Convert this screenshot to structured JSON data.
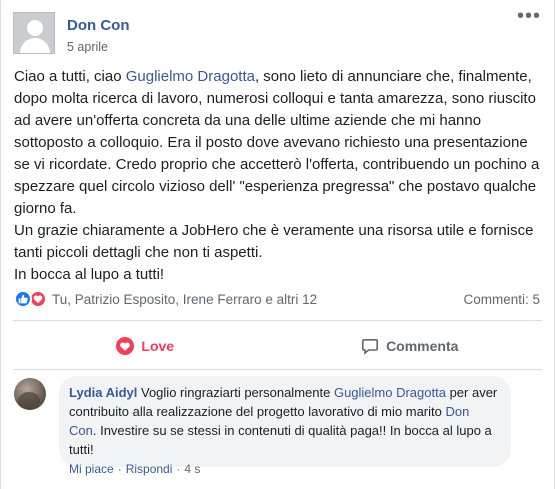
{
  "post": {
    "author": "Don Con",
    "date": "5 aprile",
    "more_glyph": "•••",
    "paragraphs": [
      {
        "t1": "Ciao a tutti, ciao ",
        "mention": "Guglielmo Dragotta",
        "t2": ", sono lieto di annunciare che, finalmente, dopo molta ricerca di lavoro, numerosi colloqui e tanta amarezza, sono riuscito ad avere un'offerta concreta da una delle ultime aziende che mi hanno sottoposto a colloquio. Era il posto dove avevano richiesto una presentazione se vi ricordate. Credo proprio che accetterò l'offerta, contribuendo un pochino a spezzare quel circolo vizioso dell' \"esperienza pregressa\" che postavo qualche giorno fa."
      },
      {
        "text": "Un grazie chiaramente a JobHero che è veramente una risorsa utile e fornisce tanti piccoli dettagli che non ti aspetti."
      },
      {
        "text": "In bocca al lupo a tutti!"
      }
    ]
  },
  "reactions": {
    "names": "Tu, Patrizio Esposito, Irene Ferraro e altri 12",
    "comments_count": "Commenti: 5",
    "colors": {
      "like": "#1877f2",
      "love": "#f33e58"
    }
  },
  "actions": {
    "love_label": "Love",
    "comment_label": "Commenta"
  },
  "comment": {
    "author": "Lydia Aidyl",
    "t1": " Voglio ringraziarti personalmente ",
    "mention1": "Guglielmo Dragotta",
    "t2": " per aver contribuito alla realizzazione del progetto lavorativo di mio marito ",
    "mention2": "Don Con",
    "t3": ". Investire su se stessi in contenuti di qualità paga!! In bocca al lupo a tutti!",
    "like_label": "Mi piace",
    "reply_label": "Rispondi",
    "time": "4 s",
    "separator": "·"
  }
}
